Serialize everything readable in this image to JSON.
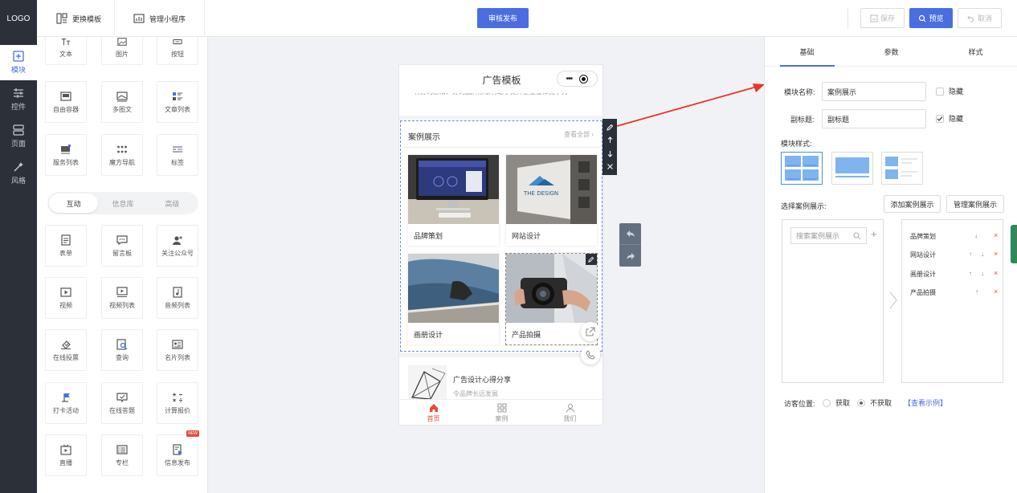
{
  "topbar": {
    "logo": "LOGO",
    "change_template": "更换模板",
    "manage_app": "管理小程序",
    "publish": "审核发布",
    "save": "保存",
    "preview": "预览",
    "cancel": "取消"
  },
  "leftnav": [
    "模块",
    "控件",
    "页面",
    "风格"
  ],
  "modules": {
    "top_row": [
      {
        "label": "文本",
        "icon": "text-icon"
      },
      {
        "label": "图片",
        "icon": "image-icon"
      },
      {
        "label": "按钮",
        "icon": "button-icon"
      }
    ],
    "basic": [
      {
        "label": "自由容器",
        "icon": "container-icon"
      },
      {
        "label": "多图文",
        "icon": "multi-image-text-icon"
      },
      {
        "label": "文章列表",
        "icon": "article-list-icon"
      },
      {
        "label": "服务列表",
        "icon": "service-list-icon"
      },
      {
        "label": "魔方导航",
        "icon": "grid-nav-icon"
      },
      {
        "label": "标签",
        "icon": "tag-icon"
      }
    ],
    "group_tabs": [
      "互动",
      "信息库",
      "高级"
    ],
    "interactive": [
      {
        "label": "表单",
        "icon": "form-icon"
      },
      {
        "label": "留言板",
        "icon": "message-board-icon"
      },
      {
        "label": "关注公众号",
        "icon": "follow-icon"
      },
      {
        "label": "视频",
        "icon": "video-icon"
      },
      {
        "label": "视频列表",
        "icon": "video-list-icon"
      },
      {
        "label": "音频列表",
        "icon": "audio-list-icon"
      },
      {
        "label": "在线投票",
        "icon": "vote-icon"
      },
      {
        "label": "查询",
        "icon": "query-icon"
      },
      {
        "label": "名片列表",
        "icon": "card-list-icon"
      },
      {
        "label": "打卡活动",
        "icon": "checkin-icon"
      },
      {
        "label": "在线答题",
        "icon": "quiz-icon"
      },
      {
        "label": "计算报价",
        "icon": "calculator-icon"
      },
      {
        "label": "直播",
        "icon": "live-icon"
      },
      {
        "label": "专栏",
        "icon": "column-icon"
      },
      {
        "label": "信息发布",
        "icon": "publish-info-icon"
      }
    ],
    "new_badge": "NEW"
  },
  "phone": {
    "title": "广告模板",
    "capsule_dots": "•••",
    "banner_text": "有好的剧情、好的品牌形象有助于提升企业整体竞争力",
    "case_block": {
      "title": "案例展示",
      "more": "查看全部",
      "cards": [
        "品牌策划",
        "网站设计",
        "画册设计",
        "产品拍摄"
      ]
    },
    "article": {
      "title": "广告设计心得分享",
      "subtitle": "令品牌长远发展"
    },
    "tabbar": [
      "首页",
      "案例",
      "我们"
    ],
    "design_sign": "THE DESIGN"
  },
  "props": {
    "tabs": [
      "基础",
      "参数",
      "样式"
    ],
    "module_name_label": "模块名称:",
    "module_name_value": "案例展示",
    "subtitle_label": "副标题:",
    "subtitle_value": "副标题",
    "hide_label": "隐藏",
    "hide_label_2": "隐藏",
    "style_label": "模块样式:",
    "select_label": "选择案例展示:",
    "add_button": "添加案例展示",
    "manage_button": "管理案例展示",
    "search_placeholder": "搜索案例展示",
    "selected": [
      "品牌策划",
      "网站设计",
      "画册设计",
      "产品拍摄"
    ],
    "visitor_label": "访客位置:",
    "opt_get": "获取",
    "opt_noget": "不获取",
    "example_link": "【查看示例】"
  },
  "colors": {
    "accent": "#4a6ee0",
    "nav_dark": "#2b3039",
    "danger": "#e84a3a",
    "arrow": "#e8362a"
  }
}
